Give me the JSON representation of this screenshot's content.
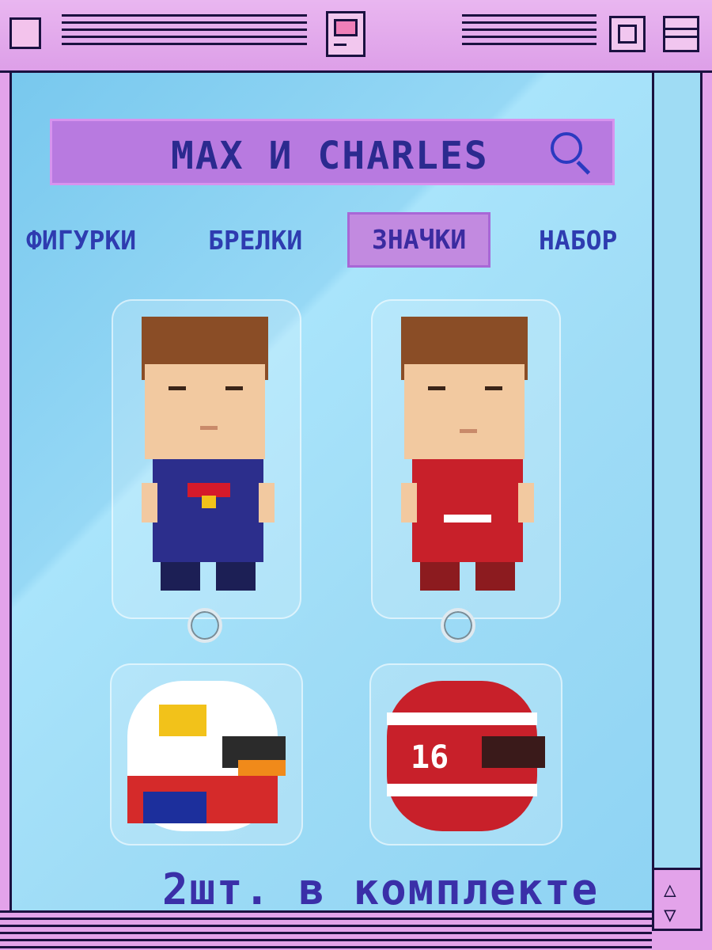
{
  "search": {
    "query": "MAX И CHARLES",
    "icon": "search-icon"
  },
  "tabs": [
    {
      "label": "ФИГУРКИ",
      "active": false
    },
    {
      "label": "БРЕЛКИ",
      "active": false
    },
    {
      "label": "ЗНАЧКИ",
      "active": true
    },
    {
      "label": "НАБОР",
      "active": false
    }
  ],
  "characters": [
    {
      "name": "max-figure",
      "suit_color": "#2c2e8c",
      "accent": "#d51a2a",
      "helmet_color": "#1c2f9c"
    },
    {
      "name": "charles-figure",
      "suit_color": "#c8202a",
      "accent": "#ffffff",
      "helmet_color": "#c8202a"
    }
  ],
  "helmet_numbers": {
    "charles": "16"
  },
  "footer": {
    "text": "2шт. в комплекте"
  },
  "colors": {
    "frame": "#e3a3ea",
    "panel": "#9fdcf6",
    "text": "#2e3cb0",
    "border": "#1b1140"
  }
}
